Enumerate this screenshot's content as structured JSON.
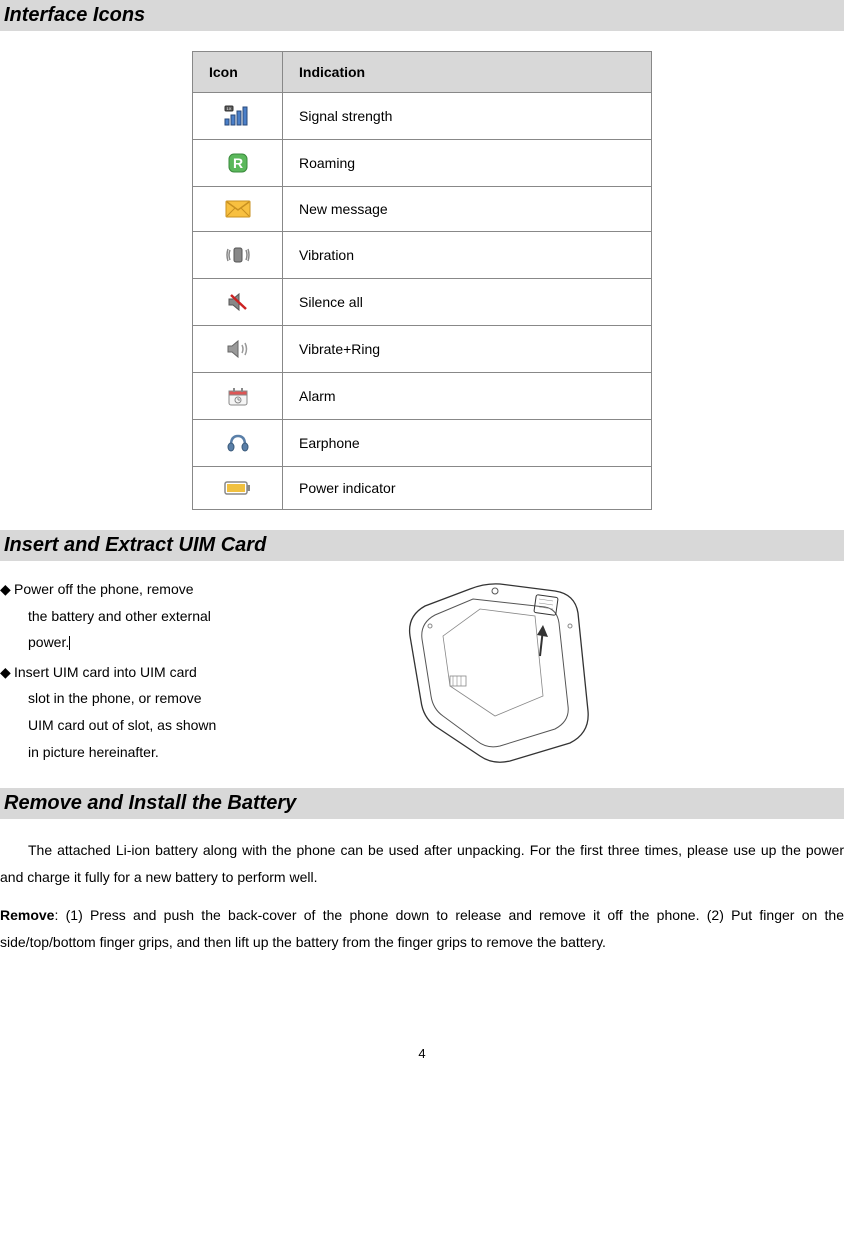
{
  "sections": {
    "interface_icons": {
      "heading": "Interface Icons",
      "table": {
        "headers": {
          "icon": "Icon",
          "indication": "Indication"
        },
        "rows": [
          {
            "icon_name": "signal-strength-icon",
            "indication": "Signal strength"
          },
          {
            "icon_name": "roaming-icon",
            "indication": "Roaming"
          },
          {
            "icon_name": "new-message-icon",
            "indication": "New message"
          },
          {
            "icon_name": "vibration-icon",
            "indication": "Vibration"
          },
          {
            "icon_name": "silence-all-icon",
            "indication": "Silence all"
          },
          {
            "icon_name": "vibrate-ring-icon",
            "indication": "Vibrate+Ring"
          },
          {
            "icon_name": "alarm-icon",
            "indication": "Alarm"
          },
          {
            "icon_name": "earphone-icon",
            "indication": "Earphone"
          },
          {
            "icon_name": "power-indicator-icon",
            "indication": "Power indicator"
          }
        ]
      }
    },
    "insert_uim": {
      "heading": "Insert and Extract UIM Card",
      "bullets": [
        {
          "line1": "Power off the phone, remove",
          "line2": "the battery and other external",
          "line3": "power."
        },
        {
          "line1": "Insert UIM card into UIM card",
          "line2": "slot in the phone, or remove",
          "line3": "UIM card out of slot, as shown",
          "line4": "in picture hereinafter."
        }
      ]
    },
    "battery": {
      "heading": "Remove and Install the Battery",
      "para1": "The attached Li-ion battery along with the phone can be used after unpacking. For the first three times, please use up the power and charge it fully for a new battery to perform well.",
      "para2_label": "Remove",
      "para2_rest": ": (1) Press and push the back-cover of the phone down to release and remove it off the phone.    (2) Put finger on the side/top/bottom finger grips, and then lift up the battery from the finger grips to remove the battery."
    }
  },
  "bullet_symbol": "◆",
  "page_number": "4"
}
